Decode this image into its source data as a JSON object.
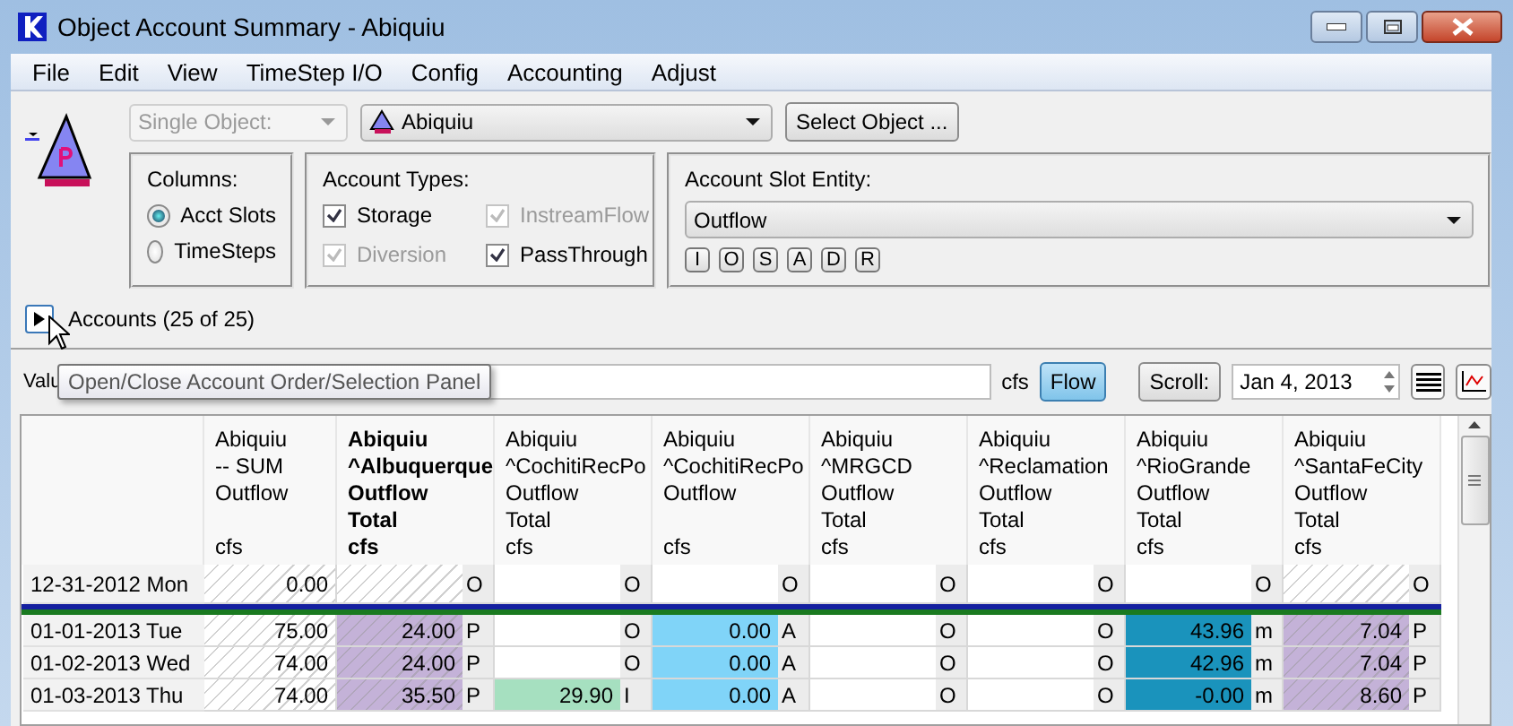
{
  "window": {
    "title": "Object Account Summary - Abiquiu"
  },
  "menu": [
    "File",
    "Edit",
    "View",
    "TimeStep I/O",
    "Config",
    "Accounting",
    "Adjust"
  ],
  "object_selector": {
    "mode": "Single Object:",
    "mode_disabled": true,
    "object": "Abiquiu",
    "select_button": "Select Object ..."
  },
  "columns_group": {
    "title": "Columns:",
    "options": [
      {
        "label": "Acct Slots",
        "selected": true
      },
      {
        "label": "TimeSteps",
        "selected": false
      }
    ]
  },
  "account_types": {
    "title": "Account Types:",
    "items": [
      {
        "label": "Storage",
        "checked": true,
        "disabled": false
      },
      {
        "label": "InstreamFlow",
        "checked": true,
        "disabled": true
      },
      {
        "label": "Diversion",
        "checked": true,
        "disabled": true
      },
      {
        "label": "PassThrough",
        "checked": true,
        "disabled": false
      }
    ]
  },
  "slot_entity": {
    "title": "Account Slot Entity:",
    "value": "Outflow",
    "buttons": [
      "I",
      "O",
      "S",
      "A",
      "D",
      "R"
    ]
  },
  "accounts": {
    "label": "Accounts (25 of 25)",
    "expanded": false
  },
  "value_bar": {
    "label": "Valu",
    "unit": "cfs",
    "flow_button": {
      "label": "Flow",
      "on": true
    },
    "scroll_button": "Scroll:",
    "date": "Jan 4, 2013"
  },
  "tooltip": "Open/Close Account Order/Selection Panel",
  "table": {
    "columns": [
      {
        "object": "Abiquiu",
        "account": "-- SUM",
        "slot": "Outflow",
        "unit": "cfs",
        "selected": false
      },
      {
        "object": "Abiquiu",
        "account": "^Albuquerque",
        "slot": "Outflow",
        "type": "Total",
        "unit": "cfs",
        "selected": true
      },
      {
        "object": "Abiquiu",
        "account": "^CochitiRecPo",
        "slot": "Outflow",
        "type": "Total",
        "unit": "cfs",
        "selected": false
      },
      {
        "object": "Abiquiu",
        "account": "^CochitiRecPo",
        "slot": "Outflow",
        "unit": "cfs",
        "selected": false
      },
      {
        "object": "Abiquiu",
        "account": "^MRGCD",
        "slot": "Outflow",
        "type": "Total",
        "unit": "cfs",
        "selected": false
      },
      {
        "object": "Abiquiu",
        "account": "^Reclamation",
        "slot": "Outflow",
        "type": "Total",
        "unit": "cfs",
        "selected": false
      },
      {
        "object": "Abiquiu",
        "account": "^RioGrande",
        "slot": "Outflow",
        "type": "Total",
        "unit": "cfs",
        "selected": false
      },
      {
        "object": "Abiquiu",
        "account": "^SantaFeCity",
        "slot": "Outflow",
        "type": "Total",
        "unit": "cfs",
        "selected": false
      }
    ],
    "rows": [
      {
        "date": "12-31-2012 Mon",
        "kind": "initial",
        "cells": [
          {
            "value": "0.00",
            "hatched": true
          },
          {
            "flag": "O",
            "hatched": true
          },
          {
            "flag": "O",
            "hatched": false
          },
          {
            "flag": "O",
            "hatched": false
          },
          {
            "flag": "O",
            "hatched": false
          },
          {
            "flag": "O",
            "hatched": false
          },
          {
            "flag": "O",
            "hatched": false
          },
          {
            "flag": "O",
            "hatched": true
          }
        ]
      },
      {
        "date": "01-01-2013 Tue",
        "kind": "step",
        "cells": [
          {
            "value": "75.00",
            "hatched": true
          },
          {
            "value": "24.00",
            "flag": "P",
            "color": "#c4b2d8",
            "hatched": true
          },
          {
            "flag": "O",
            "hatched": false
          },
          {
            "value": "0.00",
            "flag": "A",
            "color": "#80d4f8",
            "hatched": false
          },
          {
            "flag": "O",
            "hatched": false
          },
          {
            "flag": "O",
            "hatched": false
          },
          {
            "value": "43.96",
            "flag": "m",
            "color": "#1a93bc",
            "hatched": false
          },
          {
            "value": "7.04",
            "flag": "P",
            "color": "#c4b2d8",
            "hatched": true
          }
        ]
      },
      {
        "date": "01-02-2013 Wed",
        "kind": "step",
        "cells": [
          {
            "value": "74.00",
            "hatched": true
          },
          {
            "value": "24.00",
            "flag": "P",
            "color": "#c4b2d8",
            "hatched": true
          },
          {
            "flag": "O",
            "hatched": false
          },
          {
            "value": "0.00",
            "flag": "A",
            "color": "#80d4f8",
            "hatched": false
          },
          {
            "flag": "O",
            "hatched": false
          },
          {
            "flag": "O",
            "hatched": false
          },
          {
            "value": "42.96",
            "flag": "m",
            "color": "#1a93bc",
            "hatched": false
          },
          {
            "value": "7.04",
            "flag": "P",
            "color": "#c4b2d8",
            "hatched": true
          }
        ]
      },
      {
        "date": "01-03-2013 Thu",
        "kind": "step",
        "cells": [
          {
            "value": "74.00",
            "hatched": true
          },
          {
            "value": "35.50",
            "flag": "P",
            "color": "#c4b2d8",
            "hatched": true
          },
          {
            "value": "29.90",
            "flag": "I",
            "color": "#a6e0c0",
            "hatched": false
          },
          {
            "value": "0.00",
            "flag": "A",
            "color": "#80d4f8",
            "hatched": false
          },
          {
            "flag": "O",
            "hatched": false
          },
          {
            "flag": "O",
            "hatched": false
          },
          {
            "value": "-0.00",
            "flag": "m",
            "color": "#1a93bc",
            "hatched": false
          },
          {
            "value": "8.60",
            "flag": "P",
            "color": "#c4b2d8",
            "hatched": true
          }
        ]
      }
    ]
  }
}
